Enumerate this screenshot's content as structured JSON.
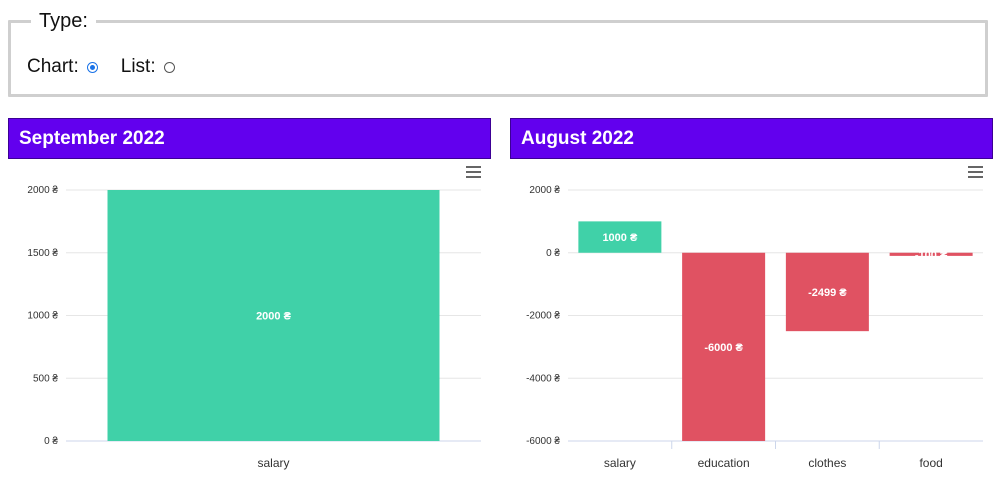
{
  "type_selector": {
    "legend": "Type:",
    "options": [
      {
        "label": "Chart:",
        "checked": true
      },
      {
        "label": "List:",
        "checked": false
      }
    ]
  },
  "colors": {
    "header": "#6200ee",
    "positive": "#40d1a8",
    "negative": "#e05262"
  },
  "chart_data": [
    {
      "type": "bar",
      "title": "September 2022",
      "categories": [
        "salary"
      ],
      "values": [
        2000
      ],
      "data_labels": [
        "2000 ₴"
      ],
      "ylim": [
        0,
        2000
      ],
      "yticks": [
        0,
        500,
        1000,
        1500,
        2000
      ],
      "ytick_labels": [
        "0 ₴",
        "500 ₴",
        "1000 ₴",
        "1500 ₴",
        "2000 ₴"
      ],
      "grid": true
    },
    {
      "type": "bar",
      "title": "August 2022",
      "categories": [
        "salary",
        "education",
        "clothes",
        "food"
      ],
      "values": [
        1000,
        -6000,
        -2499,
        -100
      ],
      "data_labels": [
        "1000 ₴",
        "-6000 ₴",
        "-2499 ₴",
        "-100 ₴"
      ],
      "ylim": [
        -6000,
        2000
      ],
      "yticks": [
        -6000,
        -4000,
        -2000,
        0,
        2000
      ],
      "ytick_labels": [
        "-6000 ₴",
        "-4000 ₴",
        "-2000 ₴",
        "0 ₴",
        "2000 ₴"
      ],
      "grid": true
    }
  ]
}
